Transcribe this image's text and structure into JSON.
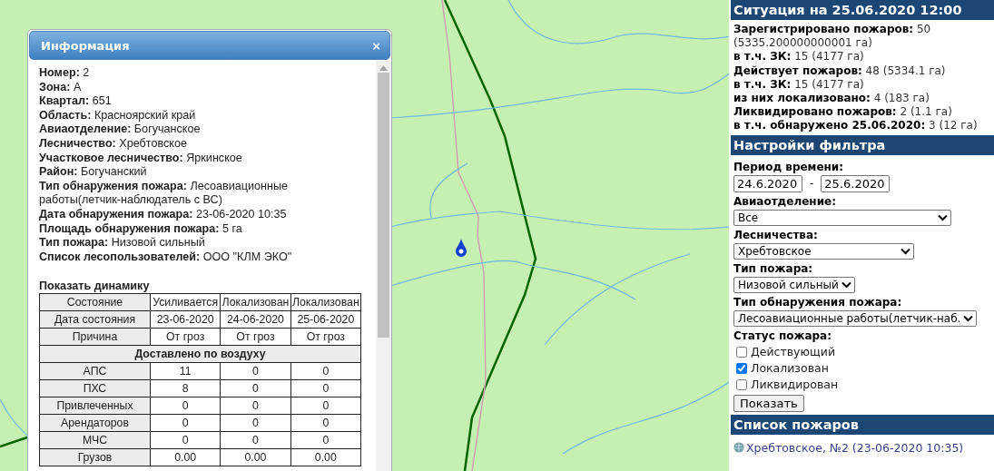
{
  "info_window": {
    "title": "Информация",
    "close": "×",
    "fields": [
      {
        "label": "Номер:",
        "value": "2"
      },
      {
        "label": "Зона:",
        "value": "А"
      },
      {
        "label": "Квартал:",
        "value": "651"
      },
      {
        "label": "Область:",
        "value": "Красноярский край"
      },
      {
        "label": "Авиаотделение:",
        "value": "Богучанское"
      },
      {
        "label": "Лесничество:",
        "value": "Хребтовское"
      },
      {
        "label": "Участковое лесничество:",
        "value": "Яркинское"
      },
      {
        "label": "Район:",
        "value": "Богучанский"
      },
      {
        "label": "Тип обнаружения пожара:",
        "value": "Лесоавиационные работы(летчик-наблюдатель с ВС)"
      },
      {
        "label": "Дата обнаружения пожара:",
        "value": "23-06-2020 10:35"
      },
      {
        "label": "Площадь обнаружения пожара:",
        "value": "5 га"
      },
      {
        "label": "Тип пожара:",
        "value": "Низовой сильный"
      },
      {
        "label": "Список лесопользователей:",
        "value": "ООО \"КЛМ ЭКО\""
      }
    ],
    "dynamics_title": "Показать динамику",
    "table": {
      "rows": [
        {
          "kind": "row",
          "cells": [
            "Состояние",
            "Усиливается",
            "Локализован",
            "Локализован"
          ]
        },
        {
          "kind": "row",
          "cells": [
            "Дата состояния",
            "23-06-2020",
            "24-06-2020",
            "25-06-2020"
          ]
        },
        {
          "kind": "row",
          "cells": [
            "Причина",
            "От гроз",
            "От гроз",
            "От гроз"
          ]
        },
        {
          "kind": "section",
          "text": "Доставлено по воздуху"
        },
        {
          "kind": "row",
          "cells": [
            "АПС",
            "11",
            "0",
            "0"
          ]
        },
        {
          "kind": "row",
          "cells": [
            "ПХС",
            "8",
            "0",
            "0"
          ]
        },
        {
          "kind": "row",
          "cells": [
            "Привлеченных",
            "0",
            "0",
            "0"
          ]
        },
        {
          "kind": "row",
          "cells": [
            "Арендаторов",
            "0",
            "0",
            "0"
          ]
        },
        {
          "kind": "row",
          "cells": [
            "МЧС",
            "0",
            "0",
            "0"
          ]
        },
        {
          "kind": "row",
          "cells": [
            "Грузов",
            "0.00",
            "0.00",
            "0.00"
          ]
        }
      ]
    }
  },
  "sidebar": {
    "situation": {
      "title": "Ситуация на 25.06.2020 12:00",
      "lines": [
        "**Зарегистрировано пожаров:** 50 (5335.200000000001 га)",
        "**в т.ч. ЗК:** 15 (4177 га)",
        "**Действует пожаров:** 48 (5334.1 га)",
        "**в т.ч. ЗК:** 15 (4177 га)",
        "**из них локализовано:** 4 (183 га)",
        "**Ликвидировано пожаров:** 2 (1.1 га)",
        "**в т.ч. обнаружено 25.06.2020:** 3 (12 га)"
      ]
    },
    "filter": {
      "title": "Настройки фильтра",
      "period": {
        "label": "Период времени:",
        "from": "24.6.2020",
        "separator": "-",
        "to": "25.6.2020"
      },
      "selects": [
        {
          "label": "Авиаотделение:",
          "value": "Все"
        },
        {
          "label": "Лесничества:",
          "value": "Хребтовское"
        },
        {
          "label": "Тип пожара:",
          "value": "Низовой сильный"
        },
        {
          "label": "Тип обнаружения пожара:",
          "value": "Лесоавиационные работы(летчик-наб."
        }
      ],
      "status": {
        "label": "Статус пожара:",
        "options": [
          {
            "label": "Действующий",
            "checked": false
          },
          {
            "label": "Локализован",
            "checked": true
          },
          {
            "label": "Ликвидирован",
            "checked": false
          }
        ]
      },
      "button": "Показать"
    },
    "fire_list": {
      "title": "Список пожаров",
      "items": [
        "Хребтовское, №2 (23-06-2020 10:35)"
      ]
    }
  }
}
